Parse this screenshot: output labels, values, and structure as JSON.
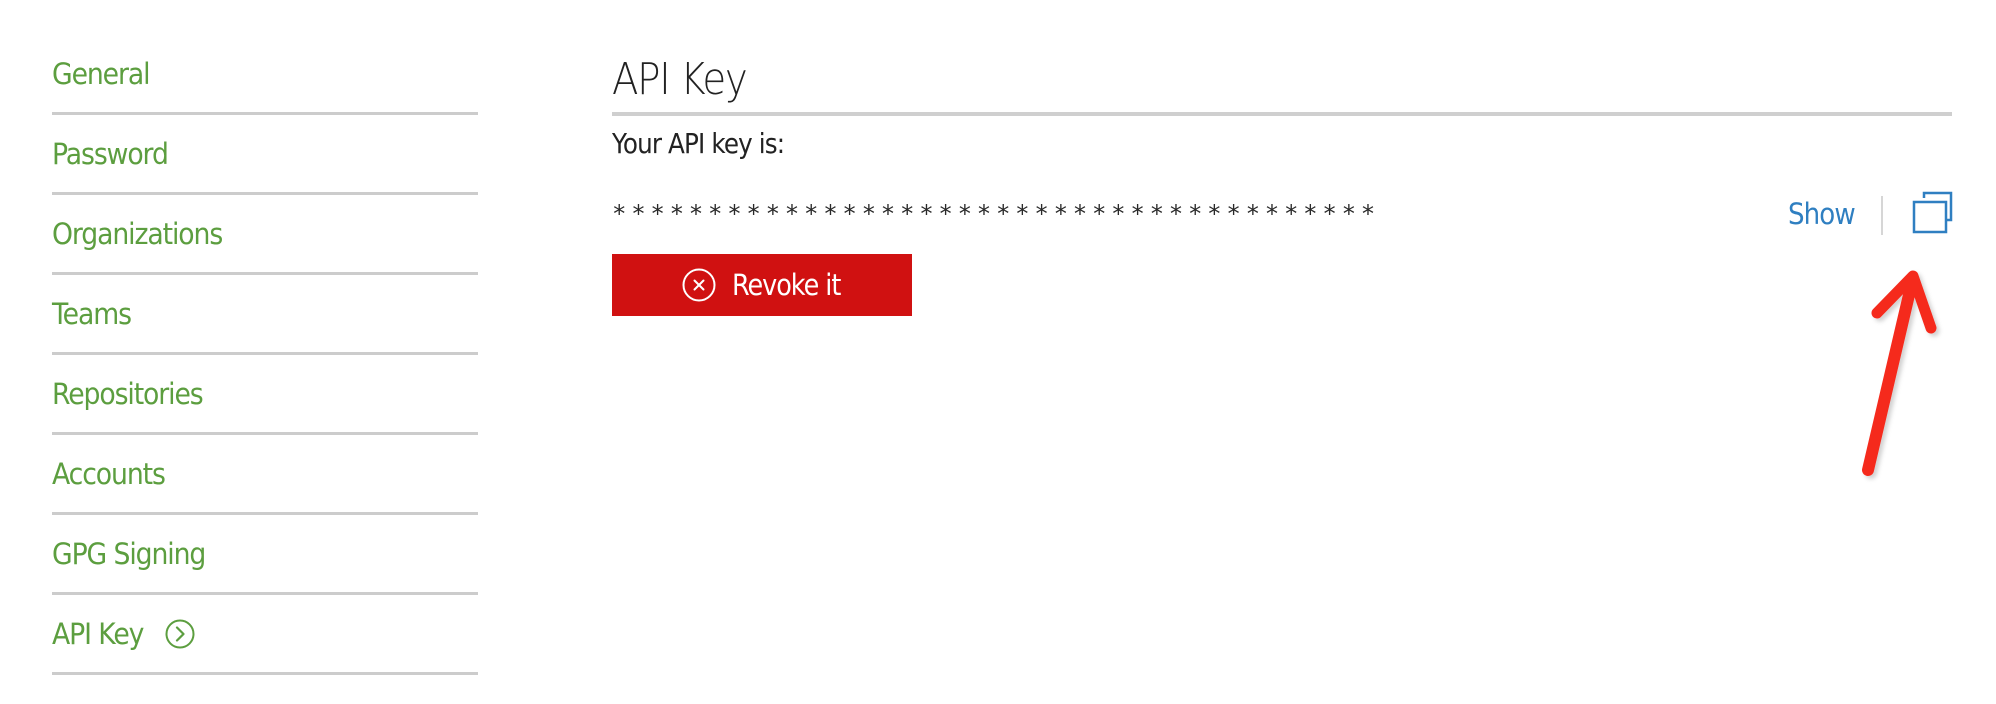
{
  "sidebar": {
    "items": [
      {
        "label": "General",
        "active": false
      },
      {
        "label": "Password",
        "active": false
      },
      {
        "label": "Organizations",
        "active": false
      },
      {
        "label": "Teams",
        "active": false
      },
      {
        "label": "Repositories",
        "active": false
      },
      {
        "label": "Accounts",
        "active": false
      },
      {
        "label": "GPG Signing",
        "active": false
      },
      {
        "label": "API Key",
        "active": true,
        "icon": "chevron-right-circle-icon"
      }
    ]
  },
  "main": {
    "title": "API Key",
    "key_label": "Your API key is:",
    "key_value": "****************************************",
    "show_label": "Show",
    "copy_icon": "copy-icon",
    "revoke_label": "Revoke it",
    "revoke_icon": "close-circle-icon"
  },
  "annotation": {
    "type": "arrow",
    "points_to": "copy-button",
    "color": "#f52a1e"
  },
  "colors": {
    "nav_text": "#5c9e3f",
    "divider": "#cccccc",
    "link": "#2f7fc1",
    "danger": "#d01111",
    "text": "#222222"
  }
}
